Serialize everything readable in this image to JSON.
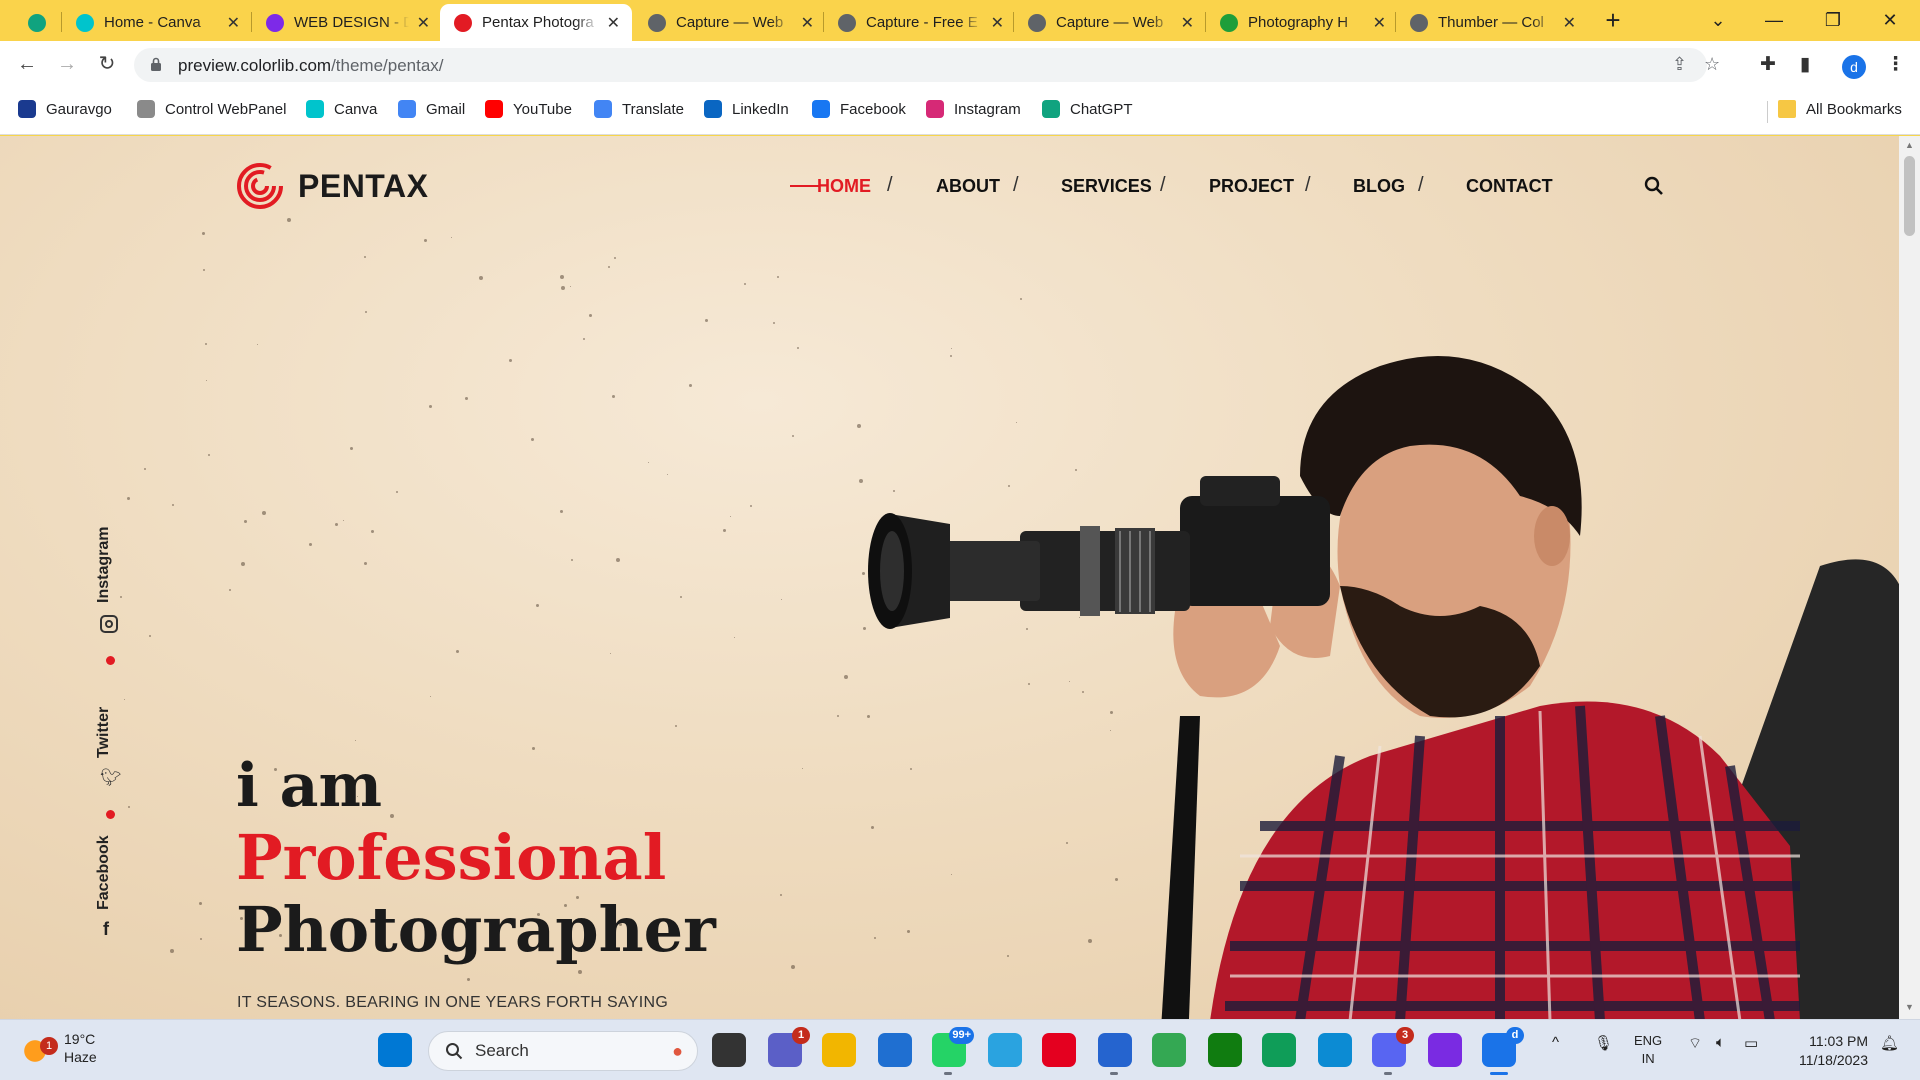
{
  "browser": {
    "tabs": [
      {
        "label": "",
        "favicon": "chatgpt-icon",
        "color": "#10a37f"
      },
      {
        "label": "Home - Canva",
        "favicon": "canva-icon",
        "color": "#00c4cc"
      },
      {
        "label": "WEB DESIGN - D",
        "favicon": "canva-icon",
        "color": "#7d2ae8"
      },
      {
        "label": "Pentax Photogra",
        "favicon": "pentax-icon",
        "color": "#e21b23",
        "active": true
      },
      {
        "label": "Capture — Web",
        "favicon": "globe-icon",
        "color": "#5f6368"
      },
      {
        "label": "Capture - Free E",
        "favicon": "globe-icon",
        "color": "#5f6368"
      },
      {
        "label": "Capture — Web",
        "favicon": "globe-icon",
        "color": "#5f6368"
      },
      {
        "label": "Photography H",
        "favicon": "check-icon",
        "color": "#1e9e3a"
      },
      {
        "label": "Thumber — Col",
        "favicon": "globe-icon",
        "color": "#5f6368"
      }
    ],
    "address": {
      "host": "preview.colorlib.com",
      "path": "/theme/pentax/"
    },
    "profile_initial": "d",
    "bookmarks": [
      {
        "label": "Gauravgo",
        "icon": "gauravgo-icon",
        "color": "#1a3a8f"
      },
      {
        "label": "Control WebPanel",
        "icon": "cwp-icon",
        "color": "#8a8a8a"
      },
      {
        "label": "Canva",
        "icon": "canva-icon",
        "color": "#00c4cc"
      },
      {
        "label": "Gmail",
        "icon": "google-icon",
        "color": "#4285f4"
      },
      {
        "label": "YouTube",
        "icon": "youtube-icon",
        "color": "#ff0000"
      },
      {
        "label": "Translate",
        "icon": "translate-icon",
        "color": "#4285f4"
      },
      {
        "label": "LinkedIn",
        "icon": "linkedin-icon",
        "color": "#0a66c2"
      },
      {
        "label": "Facebook",
        "icon": "facebook-icon",
        "color": "#1877f2"
      },
      {
        "label": "Instagram",
        "icon": "instagram-icon",
        "color": "#d62976"
      },
      {
        "label": "ChatGPT",
        "icon": "chatgpt-icon",
        "color": "#10a37f"
      }
    ],
    "all_bookmarks": "All Bookmarks"
  },
  "site": {
    "brand": "PENTAX",
    "accent": "#e21b23",
    "nav": [
      {
        "label": "HOME",
        "active": true
      },
      {
        "label": "ABOUT"
      },
      {
        "label": "SERVICES"
      },
      {
        "label": "PROJECT"
      },
      {
        "label": "BLOG"
      },
      {
        "label": "CONTACT"
      }
    ],
    "nav_separator": "/",
    "social": [
      "Instagram",
      "Twitter",
      "Facebook"
    ],
    "hero": {
      "line1": "i am",
      "line2": "Professional",
      "line3": "Photographer",
      "tagline": "IT SEASONS. BEARING IN ONE YEARS FORTH SAYING"
    }
  },
  "taskbar": {
    "weather": {
      "temp": "19°C",
      "condition": "Haze",
      "badge": "1"
    },
    "search_label": "Search",
    "apps": [
      {
        "name": "start-icon",
        "color": "#0078d4"
      },
      {
        "name": "task-view-icon",
        "color": "#333333"
      },
      {
        "name": "meet-icon",
        "color": "#5b5fc7",
        "badge": "1"
      },
      {
        "name": "file-explorer-icon",
        "color": "#f2b600"
      },
      {
        "name": "store-icon",
        "color": "#1f6fd1"
      },
      {
        "name": "whatsapp-icon",
        "color": "#25d366",
        "badge": "99+"
      },
      {
        "name": "telegram-icon",
        "color": "#2aa3e0"
      },
      {
        "name": "opera-icon",
        "color": "#e4001f"
      },
      {
        "name": "todo-icon",
        "color": "#2564cf"
      },
      {
        "name": "chrome-icon",
        "color": "#34a853"
      },
      {
        "name": "xbox-icon",
        "color": "#107c10"
      },
      {
        "name": "chat-icon",
        "color": "#0f9d58"
      },
      {
        "name": "edge-icon",
        "color": "#0c8bd3"
      },
      {
        "name": "discord-icon",
        "color": "#5865f2",
        "badge": "3"
      },
      {
        "name": "app-icon",
        "color": "#7a2be2"
      },
      {
        "name": "chrome-profile-icon",
        "color": "#1a73e8",
        "badge": "d"
      }
    ],
    "lang_line1": "ENG",
    "lang_line2": "IN",
    "time": "11:03 PM",
    "date": "11/18/2023"
  }
}
